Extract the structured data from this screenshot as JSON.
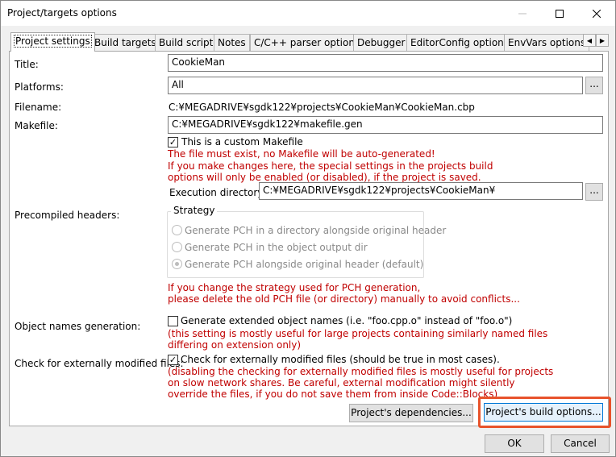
{
  "window": {
    "title": "Project/targets options",
    "minimize_icon": "minimize-icon",
    "maximize_icon": "maximize-icon",
    "close_icon": "close-icon"
  },
  "tabs": [
    {
      "label": "Project settings",
      "active": true
    },
    {
      "label": "Build targets"
    },
    {
      "label": "Build scripts"
    },
    {
      "label": "Notes"
    },
    {
      "label": "C/C++ parser options"
    },
    {
      "label": "Debugger"
    },
    {
      "label": "EditorConfig options"
    },
    {
      "label": "EnvVars options"
    }
  ],
  "tab_scroll": {
    "left": "◀",
    "right": "▶"
  },
  "fields": {
    "title_label": "Title:",
    "title_value": "CookieMan",
    "platforms_label": "Platforms:",
    "platforms_value": "All",
    "filename_label": "Filename:",
    "filename_value": "C:¥MEGADRIVE¥sgdk122¥projects¥CookieMan¥CookieMan.cbp",
    "makefile_label": "Makefile:",
    "makefile_value": "C:¥MEGADRIVE¥sgdk122¥makefile.gen",
    "custom_makefile_label": "This is a custom Makefile",
    "custom_makefile_checked": true,
    "makefile_warning_1": "The file must exist, no Makefile will be auto-generated!",
    "makefile_warning_2": "If you make changes here, the special settings in the projects build",
    "makefile_warning_3": "options will only be enabled (or disabled), if the project is saved.",
    "exec_dir_label": "Execution directory:",
    "exec_dir_value": "C:¥MEGADRIVE¥sgdk122¥projects¥CookieMan¥",
    "browse_label": "...",
    "pch_label": "Precompiled headers:",
    "strategy_title": "Strategy",
    "strategy_options": [
      {
        "label": "Generate PCH in a directory alongside original header",
        "selected": false
      },
      {
        "label": "Generate PCH in the object output dir",
        "selected": false
      },
      {
        "label": "Generate PCH alongside original header (default)",
        "selected": true
      }
    ],
    "pch_warning_1": "If you change the strategy used for PCH generation,",
    "pch_warning_2": "please delete the old PCH file (or directory) manually to avoid conflicts...",
    "objnames_label": "Object names generation:",
    "objnames_check_label": "Generate extended object names (i.e. \"foo.cpp.o\" instead of \"foo.o\")",
    "objnames_checked": false,
    "objnames_note_1": "(this setting is mostly useful for large projects containing similarly named files",
    "objnames_note_2": "differing on extension only)",
    "extmod_label": "Check for externally modified files:",
    "extmod_check_label": "Check for externally modified files (should be true in most cases).",
    "extmod_checked": true,
    "extmod_note_1": "(disabling the checking for externally modified files is mostly useful for projects",
    "extmod_note_2": "on slow network shares. Be careful, external modification might silently",
    "extmod_note_3": "override the files, if you do not save them from inside Code::Blocks)"
  },
  "buttons": {
    "dependencies": "Project's dependencies...",
    "build_options": "Project's build options...",
    "ok": "OK",
    "cancel": "Cancel"
  },
  "checkmark": "✓",
  "colors": {
    "warning_text": "#c00000",
    "highlight_border": "#e8532b",
    "focus_border": "#0078d7"
  }
}
